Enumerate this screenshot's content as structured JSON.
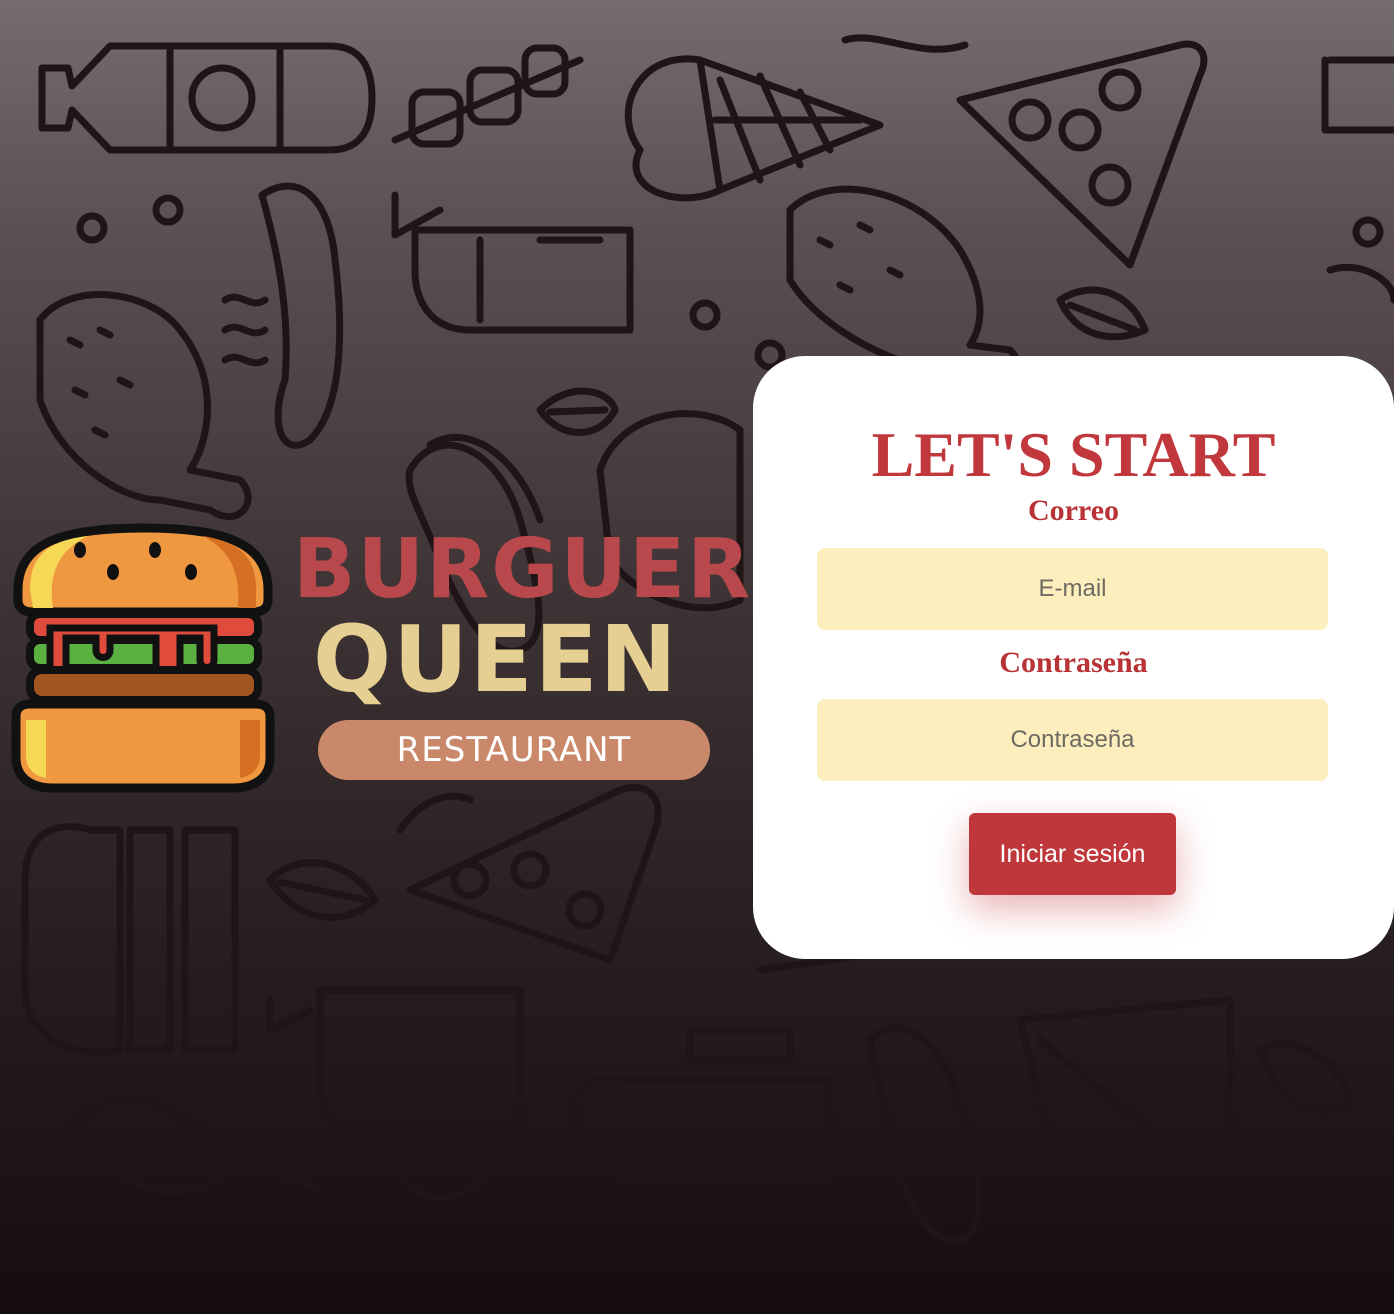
{
  "brand": {
    "name_line1": "BURGUER",
    "name_line2": "QUEEN",
    "tagline": "RESTAURANT"
  },
  "login": {
    "title": "LET'S START",
    "email_label": "Correo",
    "email_placeholder": "E-mail",
    "password_label": "Contraseña",
    "password_placeholder": "Contraseña",
    "submit_label": "Iniciar sesión"
  },
  "colors": {
    "accent_red": "#c0373b",
    "input_background": "#fdefbd",
    "brand_red": "#b8484c",
    "brand_cream": "#e6cf92",
    "tag_background": "#c9886a"
  },
  "icons": [
    "burger-logo-icon",
    "food-doodle-pattern"
  ]
}
